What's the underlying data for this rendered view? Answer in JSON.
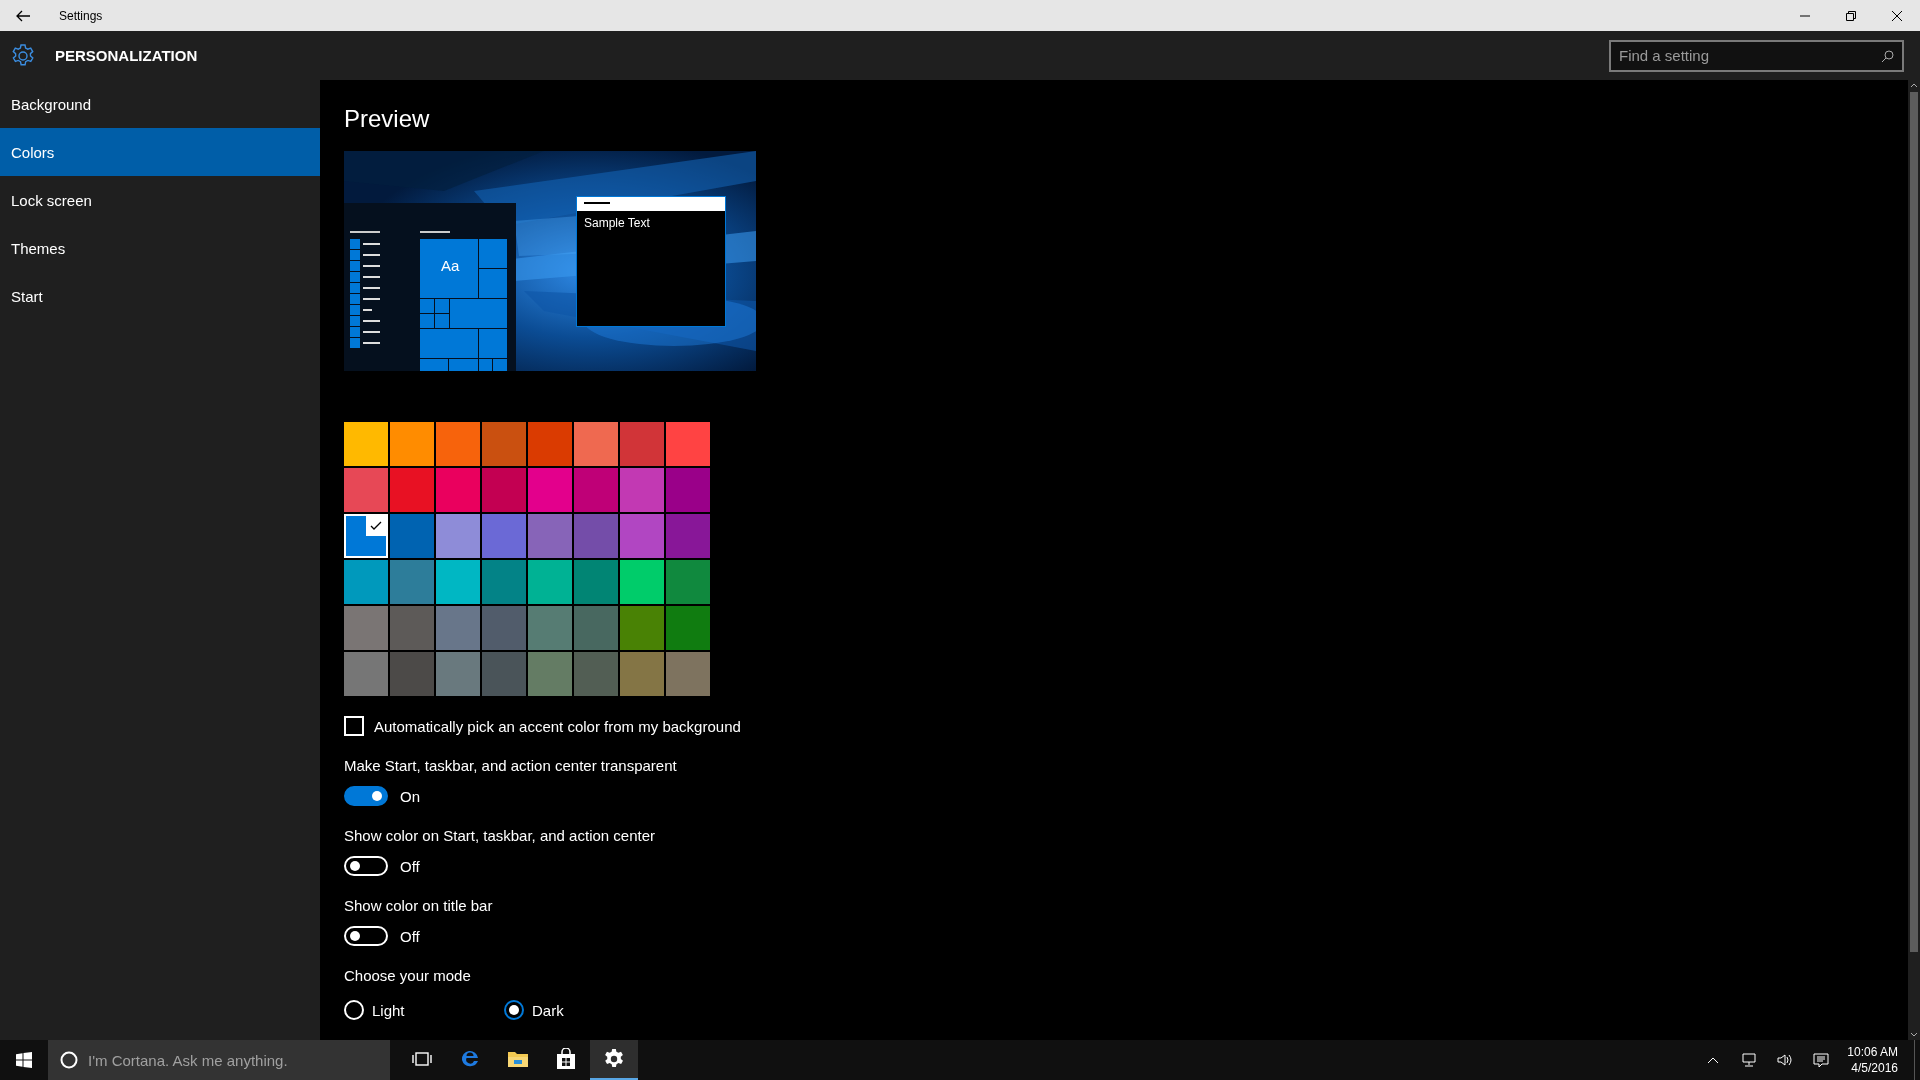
{
  "window": {
    "title": "Settings"
  },
  "header": {
    "title": "PERSONALIZATION",
    "search": {
      "placeholder": "Find a setting"
    }
  },
  "sidebar": {
    "items": [
      {
        "label": "Background",
        "selected": false
      },
      {
        "label": "Colors",
        "selected": true
      },
      {
        "label": "Lock screen",
        "selected": false
      },
      {
        "label": "Themes",
        "selected": false
      },
      {
        "label": "Start",
        "selected": false
      }
    ]
  },
  "content": {
    "heading": "Preview",
    "preview": {
      "tile_text": "Aa",
      "sample_text": "Sample Text"
    },
    "accent_colors": [
      {
        "color": "#ffb900",
        "selected": false
      },
      {
        "color": "#ff8c00",
        "selected": false
      },
      {
        "color": "#f7630c",
        "selected": false
      },
      {
        "color": "#ca5010",
        "selected": false
      },
      {
        "color": "#da3b01",
        "selected": false
      },
      {
        "color": "#ef6950",
        "selected": false
      },
      {
        "color": "#d13438",
        "selected": false
      },
      {
        "color": "#ff4343",
        "selected": false
      },
      {
        "color": "#e74856",
        "selected": false
      },
      {
        "color": "#e81123",
        "selected": false
      },
      {
        "color": "#ea005e",
        "selected": false
      },
      {
        "color": "#c30052",
        "selected": false
      },
      {
        "color": "#e3008c",
        "selected": false
      },
      {
        "color": "#bf0077",
        "selected": false
      },
      {
        "color": "#c239b3",
        "selected": false
      },
      {
        "color": "#9a0089",
        "selected": false
      },
      {
        "color": "#0078d7",
        "selected": true
      },
      {
        "color": "#0063b1",
        "selected": false
      },
      {
        "color": "#8e8cd8",
        "selected": false
      },
      {
        "color": "#6b69d6",
        "selected": false
      },
      {
        "color": "#8764b8",
        "selected": false
      },
      {
        "color": "#744da9",
        "selected": false
      },
      {
        "color": "#b146c2",
        "selected": false
      },
      {
        "color": "#881798",
        "selected": false
      },
      {
        "color": "#0099bc",
        "selected": false
      },
      {
        "color": "#2d7d9a",
        "selected": false
      },
      {
        "color": "#00b7c3",
        "selected": false
      },
      {
        "color": "#038387",
        "selected": false
      },
      {
        "color": "#00b294",
        "selected": false
      },
      {
        "color": "#018574",
        "selected": false
      },
      {
        "color": "#00cc6a",
        "selected": false
      },
      {
        "color": "#10893e",
        "selected": false
      },
      {
        "color": "#7a7574",
        "selected": false
      },
      {
        "color": "#5d5a58",
        "selected": false
      },
      {
        "color": "#68768a",
        "selected": false
      },
      {
        "color": "#515c6b",
        "selected": false
      },
      {
        "color": "#567c73",
        "selected": false
      },
      {
        "color": "#486860",
        "selected": false
      },
      {
        "color": "#498205",
        "selected": false
      },
      {
        "color": "#107c10",
        "selected": false
      },
      {
        "color": "#767676",
        "selected": false
      },
      {
        "color": "#4c4a48",
        "selected": false
      },
      {
        "color": "#69797e",
        "selected": false
      },
      {
        "color": "#4a5459",
        "selected": false
      },
      {
        "color": "#647c64",
        "selected": false
      },
      {
        "color": "#525e54",
        "selected": false
      },
      {
        "color": "#847545",
        "selected": false
      },
      {
        "color": "#7e735f",
        "selected": false
      }
    ],
    "auto_pick": {
      "label": "Automatically pick an accent color from my background",
      "checked": false
    },
    "toggles": [
      {
        "label": "Make Start, taskbar, and action center transparent",
        "on": true,
        "state_text": "On"
      },
      {
        "label": "Show color on Start, taskbar, and action center",
        "on": false,
        "state_text": "Off"
      },
      {
        "label": "Show color on title bar",
        "on": false,
        "state_text": "Off"
      }
    ],
    "mode": {
      "label": "Choose your mode",
      "options": [
        {
          "label": "Light",
          "selected": false
        },
        {
          "label": "Dark",
          "selected": true
        }
      ]
    }
  },
  "taskbar": {
    "search": {
      "placeholder": "I'm Cortana. Ask me anything."
    },
    "apps": [
      {
        "kind": "task-view",
        "active": false
      },
      {
        "kind": "browser",
        "active": false
      },
      {
        "kind": "folder",
        "active": false
      },
      {
        "kind": "store",
        "active": false
      },
      {
        "kind": "settings",
        "active": true
      }
    ],
    "clock": {
      "time": "10:06 AM",
      "date": "4/5/2016"
    }
  }
}
